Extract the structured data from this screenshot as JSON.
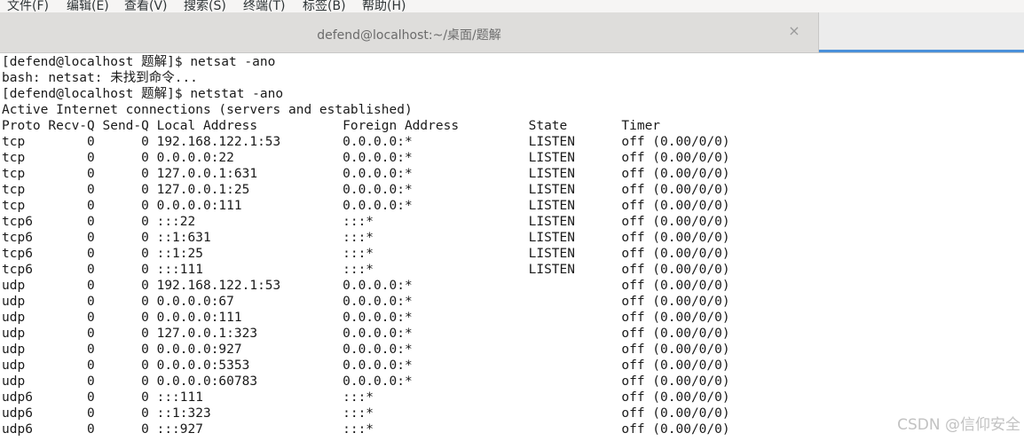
{
  "menu": [
    "文件(F)",
    "编辑(E)",
    "查看(V)",
    "搜索(S)",
    "终端(T)",
    "标签(B)",
    "帮助(H)"
  ],
  "tab": {
    "title": "defend@localhost:~/桌面/题解",
    "close": "×"
  },
  "terminal": {
    "lines": [
      "[defend@localhost 题解]$ netsat -ano",
      "bash: netsat: 未找到命令...",
      "[defend@localhost 题解]$ netstat -ano",
      "Active Internet connections (servers and established)",
      "Proto Recv-Q Send-Q Local Address           Foreign Address         State       Timer",
      "tcp        0      0 192.168.122.1:53        0.0.0.0:*               LISTEN      off (0.00/0/0)",
      "tcp        0      0 0.0.0.0:22              0.0.0.0:*               LISTEN      off (0.00/0/0)",
      "tcp        0      0 127.0.0.1:631           0.0.0.0:*               LISTEN      off (0.00/0/0)",
      "tcp        0      0 127.0.0.1:25            0.0.0.0:*               LISTEN      off (0.00/0/0)",
      "tcp        0      0 0.0.0.0:111             0.0.0.0:*               LISTEN      off (0.00/0/0)",
      "tcp6       0      0 :::22                   :::*                    LISTEN      off (0.00/0/0)",
      "tcp6       0      0 ::1:631                 :::*                    LISTEN      off (0.00/0/0)",
      "tcp6       0      0 ::1:25                  :::*                    LISTEN      off (0.00/0/0)",
      "tcp6       0      0 :::111                  :::*                    LISTEN      off (0.00/0/0)",
      "udp        0      0 192.168.122.1:53        0.0.0.0:*                           off (0.00/0/0)",
      "udp        0      0 0.0.0.0:67              0.0.0.0:*                           off (0.00/0/0)",
      "udp        0      0 0.0.0.0:111             0.0.0.0:*                           off (0.00/0/0)",
      "udp        0      0 127.0.0.1:323           0.0.0.0:*                           off (0.00/0/0)",
      "udp        0      0 0.0.0.0:927             0.0.0.0:*                           off (0.00/0/0)",
      "udp        0      0 0.0.0.0:5353            0.0.0.0:*                           off (0.00/0/0)",
      "udp        0      0 0.0.0.0:60783           0.0.0.0:*                           off (0.00/0/0)",
      "udp6       0      0 :::111                  :::*                                off (0.00/0/0)",
      "udp6       0      0 ::1:323                 :::*                                off (0.00/0/0)",
      "udp6       0      0 :::927                  :::*                                off (0.00/0/0)"
    ]
  },
  "watermark": "CSDN @信仰安全"
}
